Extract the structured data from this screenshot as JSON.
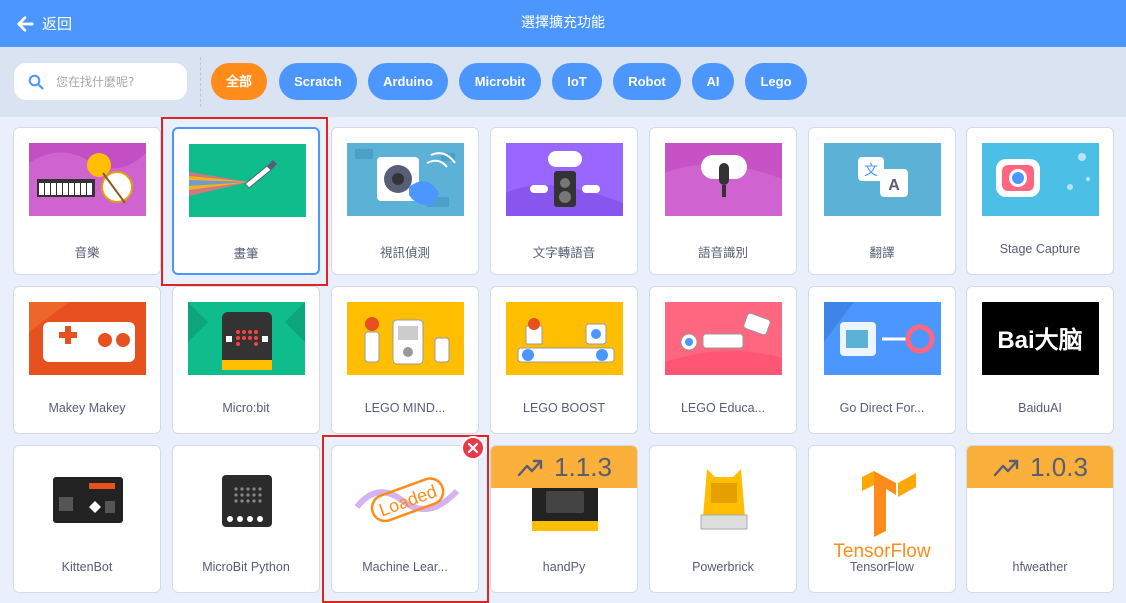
{
  "header": {
    "back_label": "返回",
    "title": "選擇擴充功能"
  },
  "search": {
    "placeholder": "您在找什麼呢?"
  },
  "filters": [
    "全部",
    "Scratch",
    "Arduino",
    "Microbit",
    "IoT",
    "Robot",
    "AI",
    "Lego"
  ],
  "active_filter": "全部",
  "extensions": [
    {
      "label": "音樂"
    },
    {
      "label": "畫筆"
    },
    {
      "label": "視訊偵測"
    },
    {
      "label": "文字轉語音"
    },
    {
      "label": "語音識別"
    },
    {
      "label": "翻譯"
    },
    {
      "label": "Stage Capture"
    },
    {
      "label": "Makey Makey"
    },
    {
      "label": "Micro:bit"
    },
    {
      "label": "LEGO MIND..."
    },
    {
      "label": "LEGO BOOST"
    },
    {
      "label": "LEGO Educa..."
    },
    {
      "label": "Go Direct For..."
    },
    {
      "label": "BaiduAI",
      "logo_text": "Bai大脑"
    },
    {
      "label": "KittenBot"
    },
    {
      "label": "MicroBit Python"
    },
    {
      "label": "Machine Lear...",
      "stamp": "Loaded"
    },
    {
      "label": "handPy",
      "version": "1.1.3"
    },
    {
      "label": "Powerbrick"
    },
    {
      "label": "TensorFlow",
      "logo_text": "TensorFlow"
    },
    {
      "label": "hfweather",
      "version": "1.0.3"
    }
  ],
  "colors": {
    "primary": "#4c97ff",
    "active": "#ff8c1a",
    "badge": "#fbb03b",
    "highlight": "#e02424"
  }
}
